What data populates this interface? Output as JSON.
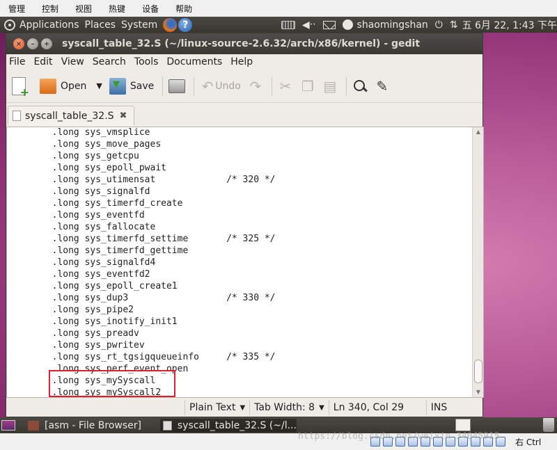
{
  "host_menu": [
    "管理",
    "控制",
    "视图",
    "热键",
    "设备",
    "帮助"
  ],
  "top_panel": {
    "applications": "Applications",
    "places": "Places",
    "system": "System",
    "help_glyph": "?",
    "user": "shaomingshan",
    "clock": "五 6月 22, 1:43 下午",
    "volume_glyph": "◀‧‧",
    "power_glyph": "⏻",
    "network_glyph": "⇅",
    "user_glyph": "x"
  },
  "window": {
    "title": "syscall_table_32.S (~/linux-source-2.6.32/arch/x86/kernel) - gedit",
    "close_glyph": "×",
    "min_glyph": "–",
    "max_glyph": "+",
    "menu": [
      "File",
      "Edit",
      "View",
      "Search",
      "Tools",
      "Documents",
      "Help"
    ],
    "toolbar": {
      "open": "Open",
      "open_arrow": "▼",
      "save": "Save",
      "undo": "Undo",
      "undo_glyph": "↶",
      "redo_glyph": "↷",
      "cut_glyph": "✂",
      "copy_glyph": "❐",
      "paste_glyph": "▤",
      "replace_glyph": "✎"
    },
    "tab": {
      "label": "syscall_table_32.S",
      "close_glyph": "✖"
    },
    "scroll_up": "▲",
    "scroll_down": "▼",
    "code_lines": [
      "        .long sys_vmsplice",
      "        .long sys_move_pages",
      "        .long sys_getcpu",
      "        .long sys_epoll_pwait",
      "        .long sys_utimensat             /* 320 */",
      "        .long sys_signalfd",
      "        .long sys_timerfd_create",
      "        .long sys_eventfd",
      "        .long sys_fallocate",
      "        .long sys_timerfd_settime       /* 325 */",
      "        .long sys_timerfd_gettime",
      "        .long sys_signalfd4",
      "        .long sys_eventfd2",
      "        .long sys_epoll_create1",
      "        .long sys_dup3                  /* 330 */",
      "        .long sys_pipe2",
      "        .long sys_inotify_init1",
      "        .long sys_preadv",
      "        .long sys_pwritev",
      "        .long sys_rt_tgsigqueueinfo     /* 335 */",
      "        .long sys_perf_event_open",
      "        .long sys_mySyscall",
      "        .long sys_mySyscall2"
    ],
    "status": {
      "syntax": "Plain Text",
      "syntax_arrow": "▼",
      "tab_width": "Tab Width:  8",
      "tab_width_arrow": "▼",
      "position": "Ln 340, Col 29",
      "mode": "INS"
    },
    "accent_highlight": "#e01e2e"
  },
  "taskbar": [
    {
      "label": "[asm - File Browser]"
    },
    {
      "label": "syscall_table_32.S (~/l..."
    }
  ],
  "vbox_status": {
    "host_key": "右 Ctrl"
  },
  "watermark": "https://blog.csdn.net/weixin_34045915"
}
